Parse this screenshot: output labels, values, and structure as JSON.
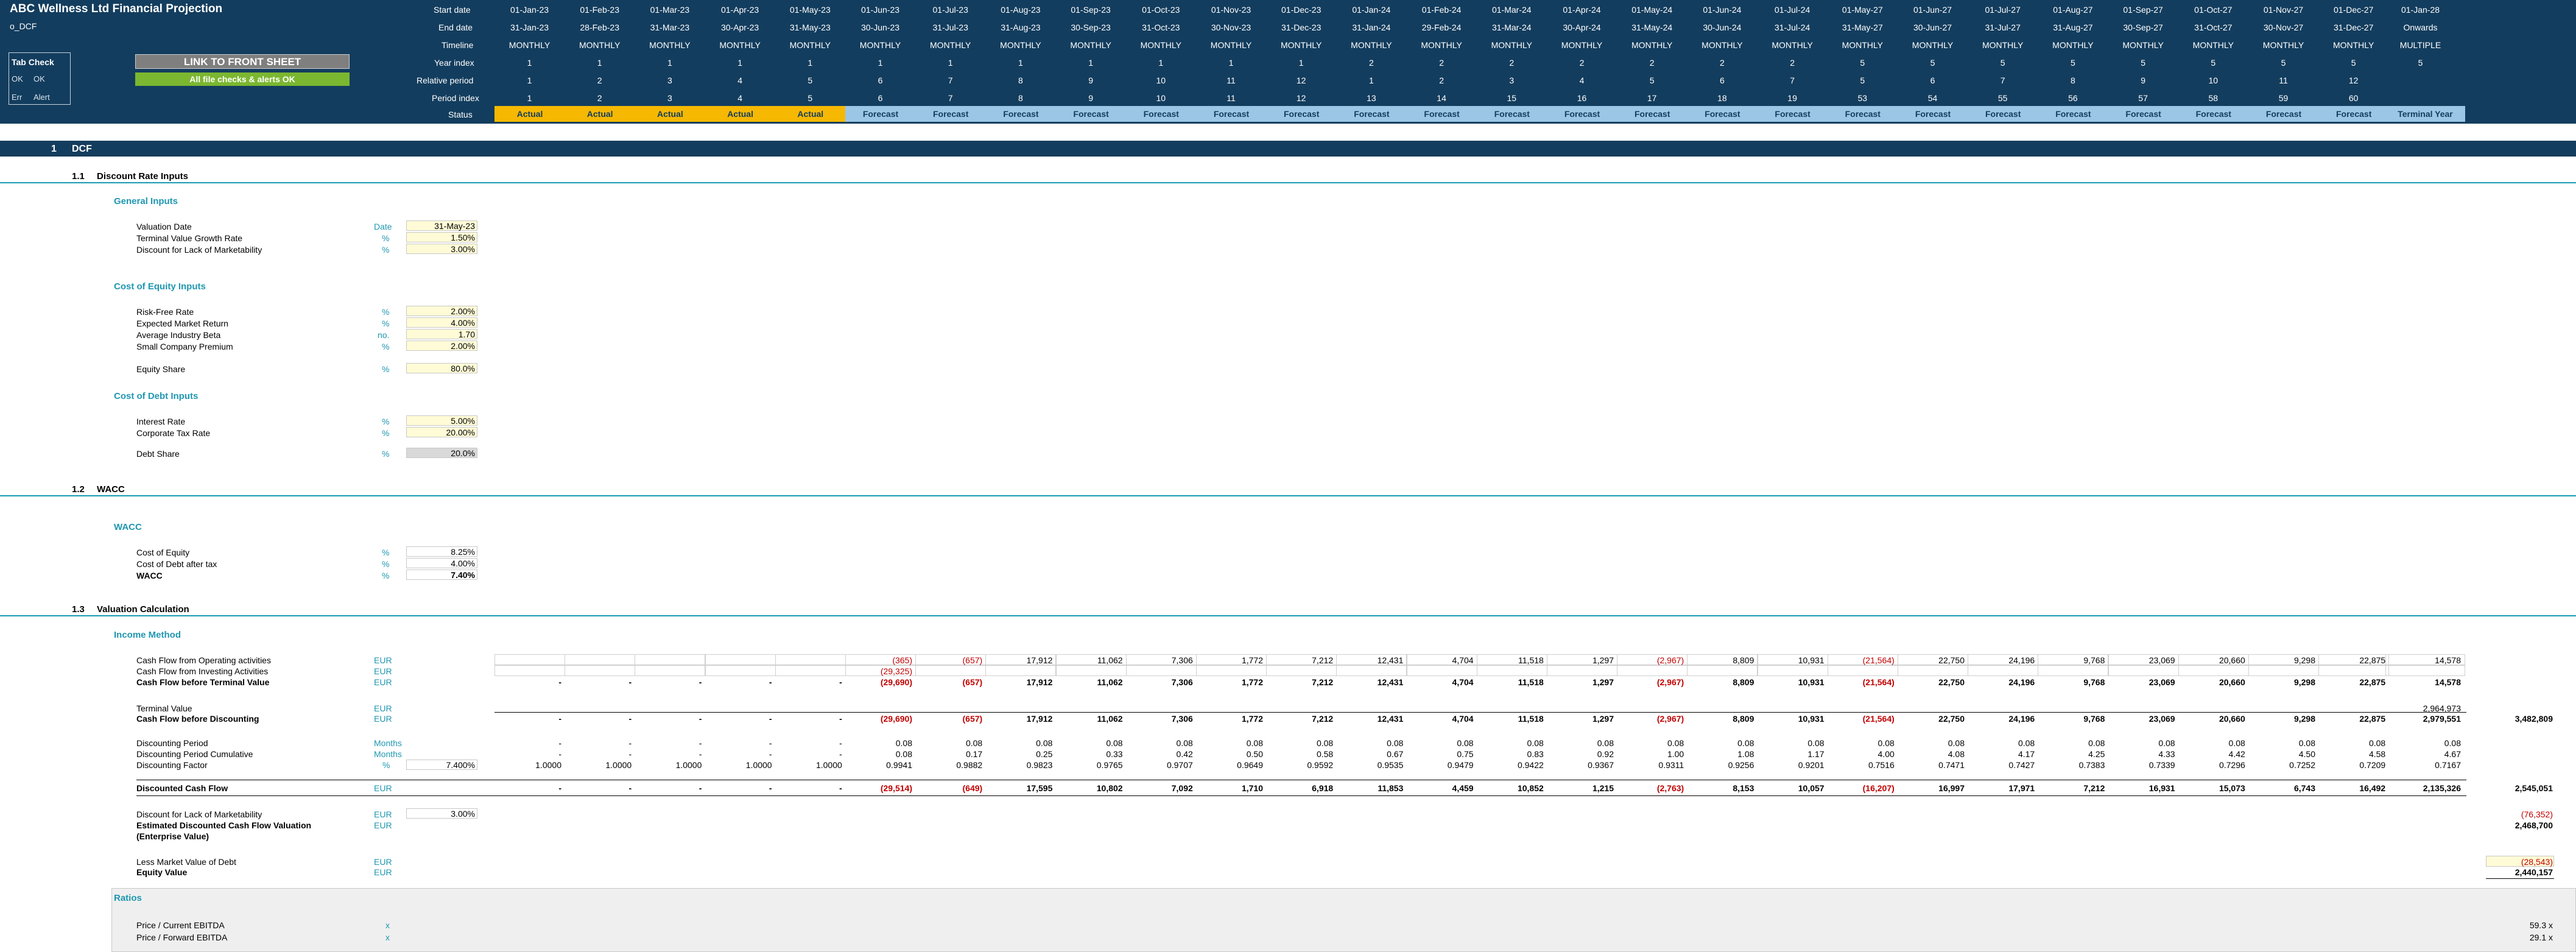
{
  "app": {
    "title": "ABC Wellness Ltd Financial Projection",
    "sheet": "o_DCF",
    "front_sheet_button": "LINK TO FRONT SHEET",
    "checks_banner": "All file checks & alerts OK",
    "tab_check": {
      "title": "Tab Check",
      "ok_code": "OK",
      "ok_label": "OK",
      "err_code": "Err",
      "err_label": "Alert"
    }
  },
  "timeline": {
    "row_labels": {
      "start": "Start date",
      "end": "End date",
      "timeline": "Timeline",
      "year": "Year index",
      "relative": "Relative period",
      "period": "Period index",
      "status": "Status"
    },
    "start": [
      "01-Jan-23",
      "01-Feb-23",
      "01-Mar-23",
      "01-Apr-23",
      "01-May-23",
      "01-Jun-23",
      "01-Jul-23",
      "01-Aug-23",
      "01-Sep-23",
      "01-Oct-23",
      "01-Nov-23",
      "01-Dec-23",
      "01-Jan-24",
      "01-Feb-24",
      "01-Mar-24",
      "01-Apr-24",
      "01-May-24",
      "01-Jun-24",
      "01-Jul-24",
      "01-May-27",
      "01-Jun-27",
      "01-Jul-27",
      "01-Aug-27",
      "01-Sep-27",
      "01-Oct-27",
      "01-Nov-27",
      "01-Dec-27",
      "01-Jan-28"
    ],
    "end": [
      "31-Jan-23",
      "28-Feb-23",
      "31-Mar-23",
      "30-Apr-23",
      "31-May-23",
      "30-Jun-23",
      "31-Jul-23",
      "31-Aug-23",
      "30-Sep-23",
      "31-Oct-23",
      "30-Nov-23",
      "31-Dec-23",
      "31-Jan-24",
      "29-Feb-24",
      "31-Mar-24",
      "30-Apr-24",
      "31-May-24",
      "30-Jun-24",
      "31-Jul-24",
      "31-May-27",
      "30-Jun-27",
      "31-Jul-27",
      "31-Aug-27",
      "30-Sep-27",
      "31-Oct-27",
      "30-Nov-27",
      "31-Dec-27",
      "Onwards"
    ],
    "type": [
      "MONTHLY",
      "MONTHLY",
      "MONTHLY",
      "MONTHLY",
      "MONTHLY",
      "MONTHLY",
      "MONTHLY",
      "MONTHLY",
      "MONTHLY",
      "MONTHLY",
      "MONTHLY",
      "MONTHLY",
      "MONTHLY",
      "MONTHLY",
      "MONTHLY",
      "MONTHLY",
      "MONTHLY",
      "MONTHLY",
      "MONTHLY",
      "MONTHLY",
      "MONTHLY",
      "MONTHLY",
      "MONTHLY",
      "MONTHLY",
      "MONTHLY",
      "MONTHLY",
      "MONTHLY",
      "MULTIPLE"
    ],
    "year": [
      "1",
      "1",
      "1",
      "1",
      "1",
      "1",
      "1",
      "1",
      "1",
      "1",
      "1",
      "1",
      "2",
      "2",
      "2",
      "2",
      "2",
      "2",
      "2",
      "5",
      "5",
      "5",
      "5",
      "5",
      "5",
      "5",
      "5",
      "5"
    ],
    "relative": [
      "1",
      "2",
      "3",
      "4",
      "5",
      "6",
      "7",
      "8",
      "9",
      "10",
      "11",
      "12",
      "1",
      "2",
      "3",
      "4",
      "5",
      "6",
      "7",
      "5",
      "6",
      "7",
      "8",
      "9",
      "10",
      "11",
      "12",
      ""
    ],
    "period": [
      "1",
      "2",
      "3",
      "4",
      "5",
      "6",
      "7",
      "8",
      "9",
      "10",
      "11",
      "12",
      "13",
      "14",
      "15",
      "16",
      "17",
      "18",
      "19",
      "53",
      "54",
      "55",
      "56",
      "57",
      "58",
      "59",
      "60",
      ""
    ],
    "status": [
      "Actual",
      "Actual",
      "Actual",
      "Actual",
      "Actual",
      "Forecast",
      "Forecast",
      "Forecast",
      "Forecast",
      "Forecast",
      "Forecast",
      "Forecast",
      "Forecast",
      "Forecast",
      "Forecast",
      "Forecast",
      "Forecast",
      "Forecast",
      "Forecast",
      "Forecast",
      "Forecast",
      "Forecast",
      "Forecast",
      "Forecast",
      "Forecast",
      "Forecast",
      "Forecast",
      "Terminal Year"
    ]
  },
  "dcf": {
    "section_no": "1",
    "section_title": "DCF",
    "discount": {
      "no": "1.1",
      "title": "Discount Rate Inputs",
      "general": {
        "title": "General Inputs",
        "rows": [
          {
            "label": "Valuation Date",
            "unit": "Date",
            "value": "31-May-23"
          },
          {
            "label": "Terminal Value Growth Rate",
            "unit": "%",
            "value": "1.50%"
          },
          {
            "label": "Discount for Lack of Marketability",
            "unit": "%",
            "value": "3.00%"
          }
        ]
      },
      "equity": {
        "title": "Cost of Equity Inputs",
        "rows": [
          {
            "label": "Risk-Free Rate",
            "unit": "%",
            "value": "2.00%"
          },
          {
            "label": "Expected Market Return",
            "unit": "%",
            "value": "4.00%"
          },
          {
            "label": "Average Industry Beta",
            "unit": "no.",
            "value": "1.70"
          },
          {
            "label": "Small Company Premium",
            "unit": "%",
            "value": "2.00%"
          }
        ],
        "share": {
          "label": "Equity Share",
          "unit": "%",
          "value": "80.0%"
        }
      },
      "debt": {
        "title": "Cost of Debt Inputs",
        "rows": [
          {
            "label": "Interest Rate",
            "unit": "%",
            "value": "5.00%"
          },
          {
            "label": "Corporate Tax Rate",
            "unit": "%",
            "value": "20.00%"
          }
        ],
        "share": {
          "label": "Debt Share",
          "unit": "%",
          "value": "20.0%"
        }
      }
    },
    "wacc": {
      "no": "1.2",
      "title": "WACC",
      "group": "WACC",
      "rows": [
        {
          "label": "Cost of Equity",
          "unit": "%",
          "value": "8.25%"
        },
        {
          "label": "Cost of Debt after tax",
          "unit": "%",
          "value": "4.00%"
        },
        {
          "label": "WACC",
          "unit": "%",
          "value": "7.40%"
        }
      ]
    },
    "valuation": {
      "no": "1.3",
      "title": "Valuation Calculation",
      "group": "Income Method",
      "rows": {
        "cfo": {
          "label": "Cash Flow from Operating activities",
          "unit": "EUR",
          "values": [
            "",
            "",
            "",
            "",
            "",
            "(365)",
            "(657)",
            "17,912",
            "11,062",
            "7,306",
            "1,772",
            "7,212",
            "12,431",
            "4,704",
            "11,518",
            "1,297",
            "(2,967)",
            "8,809",
            "10,931",
            "(21,564)",
            "22,750",
            "24,196",
            "9,768",
            "23,069",
            "20,660",
            "9,298",
            "22,875",
            "14,578"
          ]
        },
        "cfi": {
          "label": "Cash Flow from Investing Activities",
          "unit": "EUR",
          "values": [
            "",
            "",
            "",
            "",
            "",
            "(29,325)",
            "",
            "",
            "",
            "",
            "",
            "",
            "",
            "",
            "",
            "",
            "",
            "",
            "",
            "",
            "",
            "",
            "",
            "",
            "",
            "",
            "",
            ""
          ]
        },
        "cfbtv": {
          "label": "Cash Flow before Terminal Value",
          "unit": "EUR",
          "values": [
            "-",
            "-",
            "-",
            "-",
            "-",
            "(29,690)",
            "(657)",
            "17,912",
            "11,062",
            "7,306",
            "1,772",
            "7,212",
            "12,431",
            "4,704",
            "11,518",
            "1,297",
            "(2,967)",
            "8,809",
            "10,931",
            "(21,564)",
            "22,750",
            "24,196",
            "9,768",
            "23,069",
            "20,660",
            "9,298",
            "22,875",
            "14,578"
          ]
        },
        "tv": {
          "label": "Terminal Value",
          "unit": "EUR",
          "values": [
            "",
            "",
            "",
            "",
            "",
            "",
            "",
            "",
            "",
            "",
            "",
            "",
            "",
            "",
            "",
            "",
            "",
            "",
            "",
            "",
            "",
            "",
            "",
            "",
            "",
            "",
            "",
            "2,964,973"
          ]
        },
        "cfbd": {
          "label": "Cash Flow before Discounting",
          "unit": "EUR",
          "values": [
            "-",
            "-",
            "-",
            "-",
            "-",
            "(29,690)",
            "(657)",
            "17,912",
            "11,062",
            "7,306",
            "1,772",
            "7,212",
            "12,431",
            "4,704",
            "11,518",
            "1,297",
            "(2,967)",
            "8,809",
            "10,931",
            "(21,564)",
            "22,750",
            "24,196",
            "9,768",
            "23,069",
            "20,660",
            "9,298",
            "22,875",
            "2,979,551"
          ],
          "total": "3,482,809"
        },
        "dp": {
          "label": "Discounting Period",
          "unit": "Months",
          "values": [
            "-",
            "-",
            "-",
            "-",
            "-",
            "0.08",
            "0.08",
            "0.08",
            "0.08",
            "0.08",
            "0.08",
            "0.08",
            "0.08",
            "0.08",
            "0.08",
            "0.08",
            "0.08",
            "0.08",
            "0.08",
            "0.08",
            "0.08",
            "0.08",
            "0.08",
            "0.08",
            "0.08",
            "0.08",
            "0.08",
            "0.08"
          ]
        },
        "dpc": {
          "label": "Discounting Period Cumulative",
          "unit": "Months",
          "values": [
            "-",
            "-",
            "-",
            "-",
            "-",
            "0.08",
            "0.17",
            "0.25",
            "0.33",
            "0.42",
            "0.50",
            "0.58",
            "0.67",
            "0.75",
            "0.83",
            "0.92",
            "1.00",
            "1.08",
            "1.17",
            "4.00",
            "4.08",
            "4.17",
            "4.25",
            "4.33",
            "4.42",
            "4.50",
            "4.58",
            "4.67"
          ]
        },
        "df": {
          "label": "Discounting Factor",
          "unit": "%",
          "input": "7.400%",
          "values": [
            "1.0000",
            "1.0000",
            "1.0000",
            "1.0000",
            "1.0000",
            "0.9941",
            "0.9882",
            "0.9823",
            "0.9765",
            "0.9707",
            "0.9649",
            "0.9592",
            "0.9535",
            "0.9479",
            "0.9422",
            "0.9367",
            "0.9311",
            "0.9256",
            "0.9201",
            "0.7516",
            "0.7471",
            "0.7427",
            "0.7383",
            "0.7339",
            "0.7296",
            "0.7252",
            "0.7209",
            "0.7167"
          ]
        },
        "dcf": {
          "label": "Discounted Cash Flow",
          "unit": "EUR",
          "values": [
            "-",
            "-",
            "-",
            "-",
            "-",
            "(29,514)",
            "(649)",
            "17,595",
            "10,802",
            "7,092",
            "1,710",
            "6,918",
            "11,853",
            "4,459",
            "10,852",
            "1,215",
            "(2,763)",
            "8,153",
            "10,057",
            "(16,207)",
            "16,997",
            "17,971",
            "7,212",
            "16,931",
            "15,073",
            "6,743",
            "16,492",
            "2,135,326"
          ],
          "total": "2,545,051"
        },
        "dlom": {
          "label": "Discount for Lack of Marketability",
          "unit": "EUR",
          "input": "3.00%",
          "total": "(76,352)"
        },
        "edcf": {
          "label": "Estimated Discounted Cash Flow Valuation",
          "label2": "(Enterprise Value)",
          "unit": "EUR",
          "total": "2,468,700"
        },
        "debt": {
          "label": "Less Market Value of Debt",
          "unit": "EUR",
          "total": "(28,543)"
        },
        "equity": {
          "label": "Equity Value",
          "unit": "EUR",
          "total": "2,440,157"
        }
      },
      "ratios": {
        "title": "Ratios",
        "rows": [
          {
            "label": "Price / Current EBITDA",
            "unit": "x",
            "value": "59.3 x"
          },
          {
            "label": "Price / Forward EBITDA",
            "unit": "x",
            "value": "29.1 x"
          }
        ]
      }
    }
  },
  "colors": {
    "header": "#133d5e",
    "accent": "#1f97b1",
    "actual": "#f6b800",
    "forecast": "#9cc6e6",
    "ok": "#7bb730",
    "negative": "#c00000"
  }
}
